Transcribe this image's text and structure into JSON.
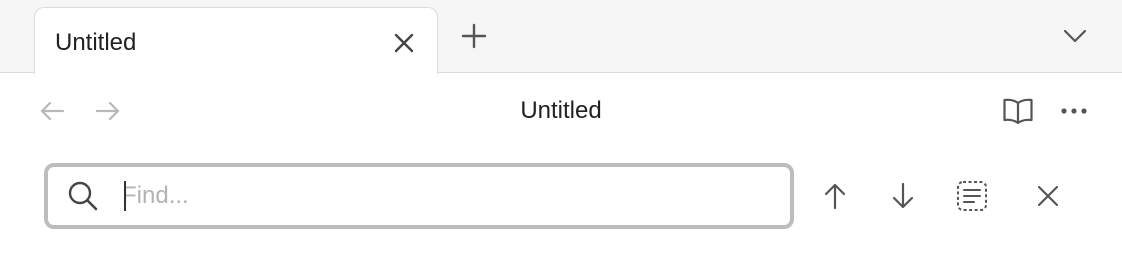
{
  "tabs": [
    {
      "label": "Untitled",
      "active": true
    }
  ],
  "header": {
    "title": "Untitled"
  },
  "find": {
    "placeholder": "Find...",
    "value": ""
  },
  "icons": {
    "tab_close": "close-icon",
    "new_tab": "plus-icon",
    "tab_menu": "chevron-down-icon",
    "back": "arrow-left-icon",
    "forward": "arrow-right-icon",
    "reader": "book-open-icon",
    "more": "more-horizontal-icon",
    "search": "search-icon",
    "previous_match": "arrow-up-icon",
    "next_match": "arrow-down-icon",
    "select_matches": "dashed-text-select-icon",
    "close_find": "close-icon"
  },
  "colors": {
    "tabbar_bg": "#f6f6f6",
    "border": "#dcdcdc",
    "text": "#222222",
    "icon": "#555555",
    "icon_disabled": "#b8b8b8",
    "find_border": "#bdbdbd",
    "placeholder": "#b3b3b3"
  }
}
